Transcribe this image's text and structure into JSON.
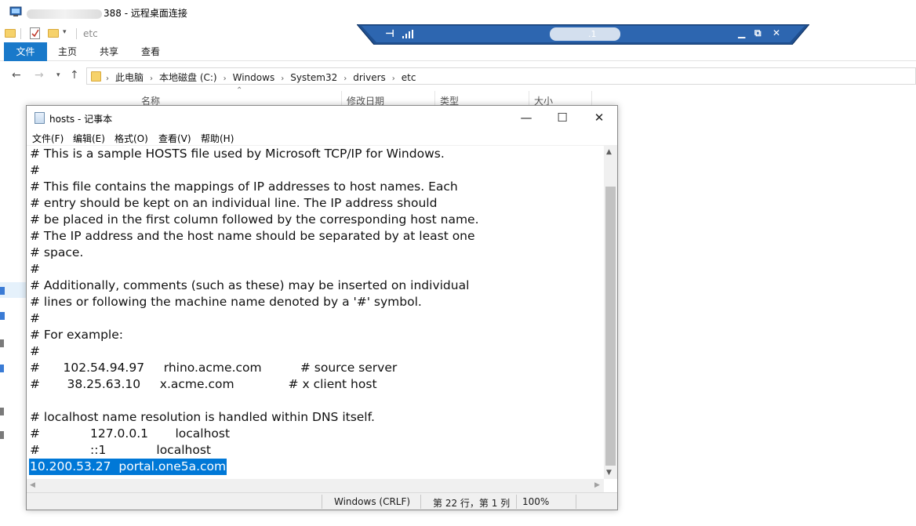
{
  "rdp": {
    "title_suffix": "388 - 远程桌面连接",
    "bar_ip_fragment": ".1"
  },
  "explorer": {
    "qat_path": "etc",
    "tabs": [
      "文件",
      "主页",
      "共享",
      "查看"
    ],
    "breadcrumbs": [
      "此电脑",
      "本地磁盘 (C:)",
      "Windows",
      "System32",
      "drivers",
      "etc"
    ],
    "columns": [
      "名称",
      "修改日期",
      "类型",
      "大小"
    ]
  },
  "notepad": {
    "title": "hosts - 记事本",
    "menu": [
      "文件(F)",
      "编辑(E)",
      "格式(O)",
      "查看(V)",
      "帮助(H)"
    ],
    "lines": [
      "# This is a sample HOSTS file used by Microsoft TCP/IP for Windows.",
      "#",
      "# This file contains the mappings of IP addresses to host names. Each",
      "# entry should be kept on an individual line. The IP address should",
      "# be placed in the first column followed by the corresponding host name.",
      "# The IP address and the host name should be separated by at least one",
      "# space.",
      "#",
      "# Additionally, comments (such as these) may be inserted on individual",
      "# lines or following the machine name denoted by a '#' symbol.",
      "#",
      "# For example:",
      "#",
      "#      102.54.94.97     rhino.acme.com          # source server",
      "#       38.25.63.10     x.acme.com              # x client host",
      "",
      "# localhost name resolution is handled within DNS itself.",
      "#             127.0.0.1       localhost",
      "#             ::1             localhost",
      "10.200.53.27  portal.one5a.com"
    ],
    "status": {
      "encoding": "Windows (CRLF)",
      "position": "第 22 行，第 1 列",
      "zoom": "100%"
    }
  }
}
